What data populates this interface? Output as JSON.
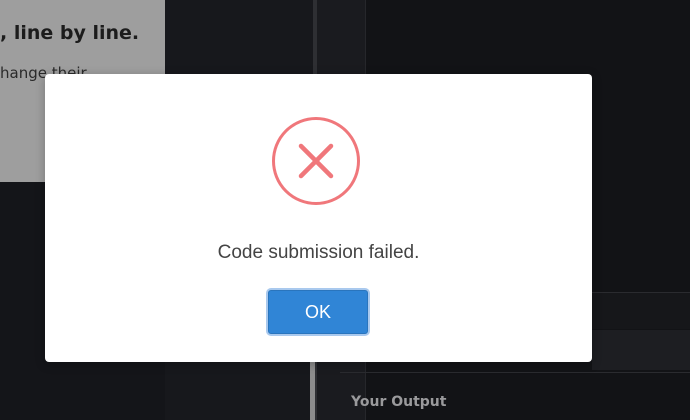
{
  "background": {
    "instructions_heading": ", line by line.",
    "instructions_text": "hange their",
    "output_label": "Your Output"
  },
  "dialog": {
    "icon": "error-x-icon",
    "message": "Code submission failed.",
    "ok_label": "OK"
  },
  "colors": {
    "error_icon": "#f0777b",
    "ok_button": "#3085d6",
    "message_text": "#444444"
  }
}
